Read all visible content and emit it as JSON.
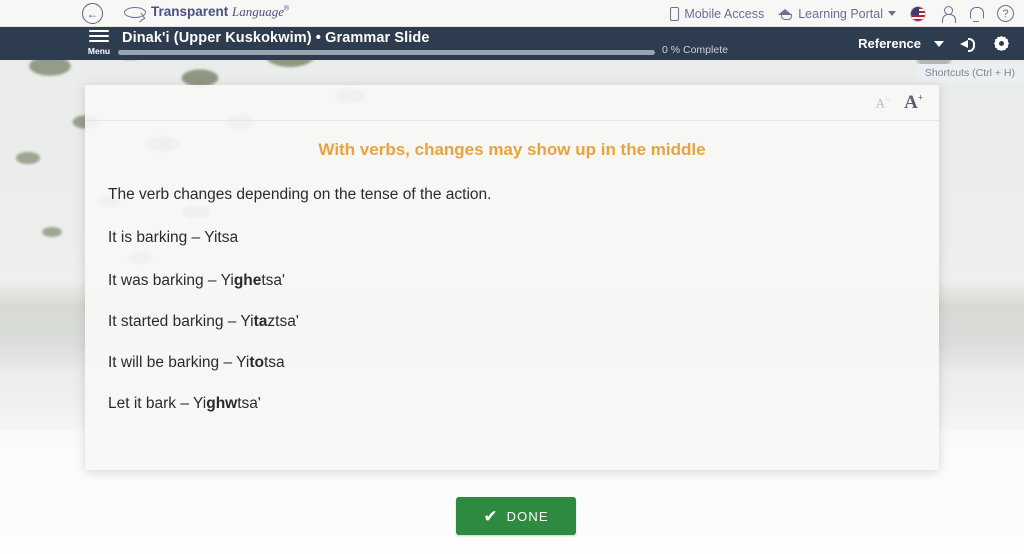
{
  "topbar": {
    "back_icon": "back-arrow-icon",
    "logo": {
      "name_bold": "Transparent",
      "name_italic": "Language",
      "trademark": "®"
    },
    "mobile_access": "Mobile Access",
    "learning_portal": "Learning Portal",
    "flag_icon": "us-flag-icon",
    "account_icon": "person-icon",
    "notifications_icon": "bell-icon",
    "help_icon": "help-icon"
  },
  "navbar": {
    "menu_label": "Menu",
    "title": "Dinak'i (Upper Kuskokwim) • Grammar Slide",
    "progress_percent": 0,
    "progress_label": "0 % Complete",
    "reference_label": "Reference",
    "audio_icon": "speaker-icon",
    "settings_icon": "gear-icon"
  },
  "shortcuts": {
    "label": "Shortcuts  (Ctrl + H)"
  },
  "card": {
    "font_decrease": "A",
    "font_decrease_sup": "−",
    "font_increase": "A",
    "font_increase_sup": "+",
    "title": "With verbs, changes may show up in the middle",
    "intro": "The verb changes depending on the tense of the action.",
    "examples": [
      {
        "english": "It is barking",
        "sep": " – ",
        "pre": "Yitsa",
        "bold": "",
        "post": ""
      },
      {
        "english": "It was barking",
        "sep": " – ",
        "pre": "Yi",
        "bold": "ghe",
        "post": "tsa'"
      },
      {
        "english": "It started barking",
        "sep": " – ",
        "pre": "Yi",
        "bold": "ta",
        "post": "ztsa'"
      },
      {
        "english": "It will be barking",
        "sep": " – ",
        "pre": "Yi",
        "bold": "to",
        "post": "tsa"
      },
      {
        "english": "Let it bark",
        "sep": " – ",
        "pre": "Yi",
        "bold": "ghw",
        "post": "tsa'"
      }
    ]
  },
  "done_button": {
    "label": "DONE",
    "check": "✔"
  },
  "colors": {
    "nav_background": "#2e3c50",
    "title_orange": "#e8a33d",
    "done_green": "#2f8a41",
    "logo_purple": "#4b4f84"
  }
}
